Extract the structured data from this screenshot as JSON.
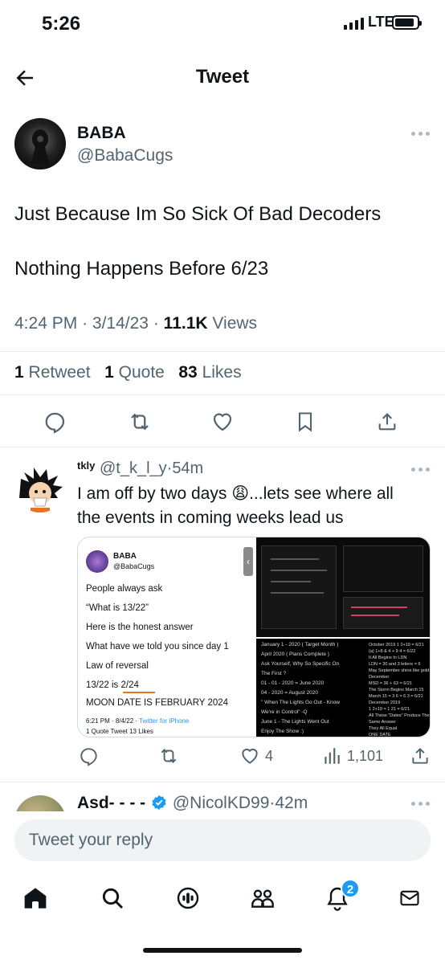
{
  "status_bar": {
    "time": "5:26",
    "network": "LTE",
    "battery_level": 0.9
  },
  "header": {
    "title": "Tweet"
  },
  "main_tweet": {
    "display_name": "BABA",
    "handle": "@BabaCugs",
    "lines": [
      "Just Because Im So Sick Of Bad Decoders",
      "Nothing Happens Before 6/23"
    ],
    "time": "4:24 PM",
    "date": "3/14/23",
    "sep": "·",
    "views_count": "11.1K",
    "views_label": "Views",
    "retweets_count": "1",
    "retweets_label": "Retweet",
    "quotes_count": "1",
    "quotes_label": "Quote",
    "likes_count": "83",
    "likes_label": "Likes"
  },
  "reply1": {
    "display_name": "tkly",
    "handle": "@t_k_l_y",
    "time": "54m",
    "text_line1": "I am off by two days 😩...lets see where all",
    "text_line2": "the events in coming weeks lead us",
    "likes": "4",
    "views": "1,101",
    "embed": {
      "name": "BABA",
      "handle": "@BabaCugs",
      "lines": [
        "People always ask",
        "“What is 13/22”",
        "Here is the honest answer",
        "What have we told you since day 1",
        "Law of reversal",
        "13/22 is 2/24",
        "MOON DATE IS FEBRUARY 2024"
      ],
      "footer_time": "6:21 PM · 8/4/22 ·",
      "footer_source": "Twitter for iPhone",
      "footer_stats": "1 Quote Tweet  13 Likes"
    },
    "dark_panel_a": [
      "January 1 - 2020 ( Target Month )",
      "April 2020 ( Plans Complete )",
      "Ask Yourself, Why So Specific On",
      "The First ?",
      "01 - 01 - 2020 = June 2020",
      "04 - 2020 = August 2020",
      "\" When The Lights Go Out - Know",
      "We're in Control\" -Q",
      "June 1 - The Lights Went Out",
      "Enjoy The Show :)"
    ],
    "dark_panel_b": [
      "October 2019  1 2+19 = 6/21",
      "(a) 1+8 & 4 + 9 4 = 6/22",
      "It All Begins In LDN",
      "LDN = 30 and 3 letters = 6",
      "May September shine like gold on",
      "December",
      "MSD = 36 + 63 = 6/21",
      "The Storm Begins March 15",
      "March 15 = 3 6 = 6 3 = 6/21",
      "December 2019",
      "1 2+19 = 1 21 = 6/21",
      "All These \"Dates\" Produce The",
      "Same Answer",
      "They All Equal",
      "ONE DATE"
    ]
  },
  "reply2": {
    "display_name": "Asd- - - -",
    "handle": "@NicolKD99",
    "time": "42m"
  },
  "reply_box": {
    "placeholder": "Tweet your reply"
  },
  "tabbar": {
    "notifications_badge": "2"
  },
  "colors": {
    "accent": "#1d9bf0",
    "text": "#0f1419",
    "secondary": "#536471"
  }
}
